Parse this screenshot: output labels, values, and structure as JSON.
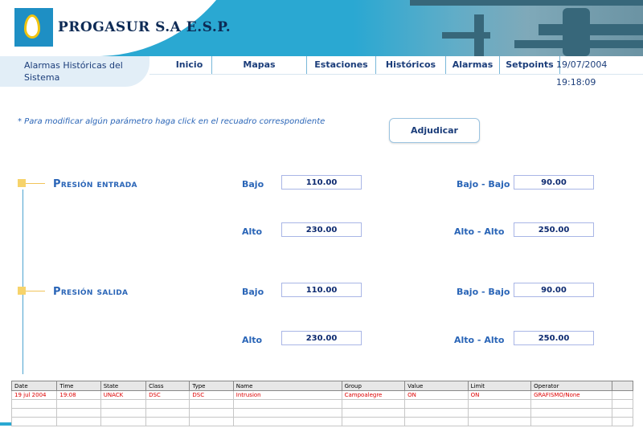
{
  "header": {
    "brand": "PROGASUR S.A  E.S.P."
  },
  "subtitle": "Alarmas Históricas del Sistema",
  "nav": {
    "items": [
      "Inicio",
      "Mapas",
      "Estaciones",
      "Históricos",
      "Alarmas",
      "Setpoints"
    ],
    "datetime": "19/07/2004  19:18:09"
  },
  "note": "* Para modificar algún parámetro haga click en el recuadro correspondiente",
  "adjudicar_label": "Adjudicar",
  "sections": [
    {
      "title": "Presión entrada",
      "bajo_label": "Bajo",
      "bajo": "110.00",
      "alto_label": "Alto",
      "alto": "230.00",
      "bajo_bajo_label": "Bajo - Bajo",
      "bajo_bajo": "90.00",
      "alto_alto_label": "Alto - Alto",
      "alto_alto": "250.00"
    },
    {
      "title": "Presión salida",
      "bajo_label": "Bajo",
      "bajo": "110.00",
      "alto_label": "Alto",
      "alto": "230.00",
      "bajo_bajo_label": "Bajo - Bajo",
      "bajo_bajo": "90.00",
      "alto_alto_label": "Alto - Alto",
      "alto_alto": "250.00"
    }
  ],
  "alarm_table": {
    "columns": [
      "Date",
      "Time",
      "State",
      "Class",
      "Type",
      "Name",
      "Group",
      "Value",
      "Limit",
      "Operator"
    ],
    "rows": [
      [
        "19 jul 2004",
        "19:08",
        "UNACK",
        "DSC",
        "DSC",
        "Intrusion",
        "Campoalegre",
        "ON",
        "ON",
        "GRAFISMO/None"
      ]
    ]
  },
  "colors": {
    "header": "#2aa8d2",
    "accent_text": "#2a65b7",
    "alarm_text": "#dd0000"
  }
}
